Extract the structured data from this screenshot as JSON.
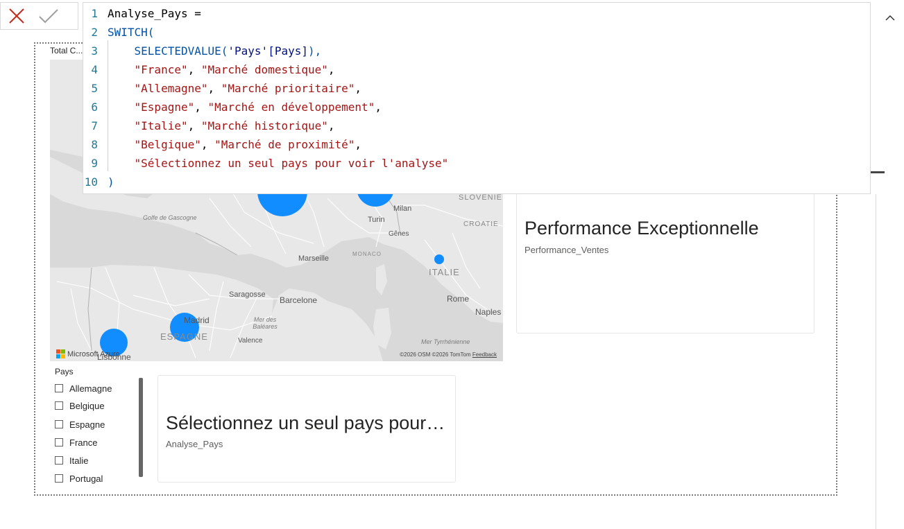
{
  "toolbar": {
    "cancel_icon": "close-icon",
    "commit_icon": "check-icon"
  },
  "editor": {
    "lines": [
      {
        "num": "1",
        "tokens": [
          {
            "t": "Analyse_Pays =",
            "c": "ident"
          }
        ]
      },
      {
        "num": "2",
        "tokens": [
          {
            "t": "SWITCH(",
            "c": "kw"
          }
        ]
      },
      {
        "num": "3",
        "tokens": [
          {
            "t": "    ",
            "c": "ident"
          },
          {
            "t": "SELECTEDVALUE(",
            "c": "fn"
          },
          {
            "t": "'Pays'[Pays]",
            "c": "tbl"
          },
          {
            "t": "),",
            "c": "paren"
          }
        ]
      },
      {
        "num": "4",
        "tokens": [
          {
            "t": "    ",
            "c": "ident"
          },
          {
            "t": "\"France\"",
            "c": "str"
          },
          {
            "t": ", ",
            "c": "ident"
          },
          {
            "t": "\"Marché domestique\"",
            "c": "str"
          },
          {
            "t": ",",
            "c": "ident"
          }
        ]
      },
      {
        "num": "5",
        "tokens": [
          {
            "t": "    ",
            "c": "ident"
          },
          {
            "t": "\"Allemagne\"",
            "c": "str"
          },
          {
            "t": ", ",
            "c": "ident"
          },
          {
            "t": "\"Marché prioritaire\"",
            "c": "str"
          },
          {
            "t": ",",
            "c": "ident"
          }
        ]
      },
      {
        "num": "6",
        "tokens": [
          {
            "t": "    ",
            "c": "ident"
          },
          {
            "t": "\"Espagne\"",
            "c": "str"
          },
          {
            "t": ", ",
            "c": "ident"
          },
          {
            "t": "\"Marché en développement\"",
            "c": "str"
          },
          {
            "t": ",",
            "c": "ident"
          }
        ]
      },
      {
        "num": "7",
        "tokens": [
          {
            "t": "    ",
            "c": "ident"
          },
          {
            "t": "\"Italie\"",
            "c": "str"
          },
          {
            "t": ", ",
            "c": "ident"
          },
          {
            "t": "\"Marché historique\"",
            "c": "str"
          },
          {
            "t": ",",
            "c": "ident"
          }
        ]
      },
      {
        "num": "8",
        "tokens": [
          {
            "t": "    ",
            "c": "ident"
          },
          {
            "t": "\"Belgique\"",
            "c": "str"
          },
          {
            "t": ", ",
            "c": "ident"
          },
          {
            "t": "\"Marché de proximité\"",
            "c": "str"
          },
          {
            "t": ",",
            "c": "ident"
          }
        ]
      },
      {
        "num": "9",
        "tokens": [
          {
            "t": "    ",
            "c": "ident"
          },
          {
            "t": "\"Sélectionnez un seul pays pour voir l'analyse\"",
            "c": "str"
          }
        ]
      },
      {
        "num": "10",
        "tokens": [
          {
            "t": ")",
            "c": "kw"
          }
        ]
      }
    ]
  },
  "visual": {
    "header_label": "Total C..."
  },
  "map": {
    "labels": {
      "golfe": "Golfe de Gascogne",
      "milan": "Milan",
      "slovenie": "SLOVÉNIE",
      "turin": "Turin",
      "croatie": "CROATIE",
      "genes": "Gênes",
      "monaco": "MONACO",
      "marseille": "Marseille",
      "italie": "ITALIE",
      "saragosse": "Saragosse",
      "barcelone": "Barcelone",
      "rome": "Rome",
      "madrid": "Madrid",
      "mer_baleares": "Mer des Baléares",
      "naples": "Naples",
      "espagne": "ESPAGNE",
      "valence": "Valence",
      "mer_tyrrhenienne": "Mer Tyrrhénienne",
      "lisbonne": "Lisbonne"
    },
    "brand": "Microsoft Azure",
    "attribution": "©2026 OSM  ©2026 TomTom",
    "feedback": "Feedback",
    "bubble_color": "#118dff"
  },
  "card_performance": {
    "value": "Performance Exceptionnelle",
    "label": "Performance_Ventes"
  },
  "card_analyse": {
    "value": "Sélectionnez un seul pays pour voir l'analyse",
    "label": "Analyse_Pays"
  },
  "slicer": {
    "title": "Pays",
    "items": [
      "Allemagne",
      "Belgique",
      "Espagne",
      "France",
      "Italie",
      "Portugal"
    ]
  }
}
